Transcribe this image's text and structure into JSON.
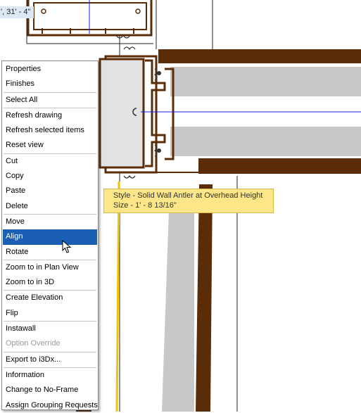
{
  "coordinate_readout": "', 31' - 4\"",
  "context_menu": {
    "groups": [
      [
        {
          "label": "Properties"
        },
        {
          "label": "Finishes"
        }
      ],
      [
        {
          "label": "Select All"
        }
      ],
      [
        {
          "label": "Refresh drawing"
        },
        {
          "label": "Refresh selected items"
        },
        {
          "label": "Reset view"
        }
      ],
      [
        {
          "label": "Cut"
        },
        {
          "label": "Copy"
        },
        {
          "label": "Paste"
        },
        {
          "label": "Delete"
        }
      ],
      [
        {
          "label": "Move"
        },
        {
          "label": "Align",
          "selected": true
        },
        {
          "label": "Rotate"
        }
      ],
      [
        {
          "label": "Zoom to in Plan View"
        },
        {
          "label": "Zoom to in 3D"
        }
      ],
      [
        {
          "label": "Create Elevation"
        },
        {
          "label": "Flip"
        }
      ],
      [
        {
          "label": "Instawall"
        },
        {
          "label": "Option Override",
          "disabled": true
        }
      ],
      [
        {
          "label": "Export to i3Dx..."
        }
      ],
      [
        {
          "label": "Information"
        },
        {
          "label": "Change to No-Frame"
        },
        {
          "label": "Assign Grouping Requests"
        }
      ]
    ]
  },
  "tooltip": {
    "line1": "Style - Solid Wall Antler at Overhead Height",
    "line2": "Size - 1' - 8 13/16\""
  },
  "colors": {
    "wood": "#5a2d08",
    "panel": "#c8c8c8",
    "highlight_line": "#f5c400",
    "axis_line": "#1a1aff",
    "menu_selected": "#1a5fb4",
    "tooltip_bg": "#fde688"
  }
}
